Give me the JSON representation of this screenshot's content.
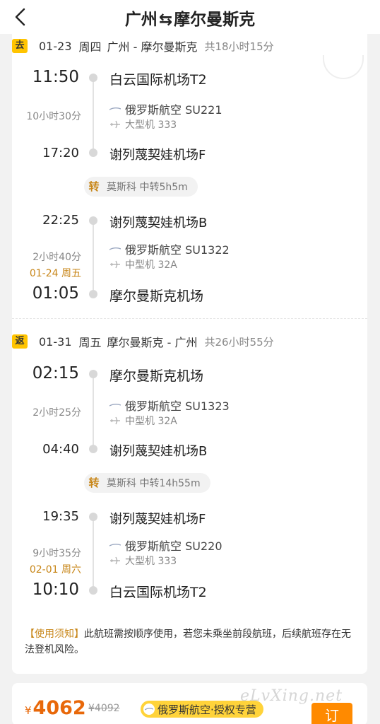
{
  "header": {
    "title_from": "广州",
    "title_arrow": "⇆",
    "title_to": "摩尔曼斯克"
  },
  "outbound": {
    "tag": "去",
    "date": "01-23",
    "weekday": "周四",
    "route": "广州 - 摩尔曼斯克",
    "total": "共18小时15分",
    "legs": [
      {
        "dep_time": "11:50",
        "dep_airport": "白云国际机场T2",
        "duration": "10小时30分",
        "airline": "俄罗斯航空 SU221",
        "aircraft": "大型机 333",
        "arr_time": "17:20",
        "arr_airport": "谢列蔑契娃机场F"
      },
      {
        "dep_time": "22:25",
        "dep_airport": "谢列蔑契娃机场B",
        "duration": "2小时40分",
        "next_day": "01-24 周五",
        "airline": "俄罗斯航空 SU1322",
        "aircraft": "中型机 32A",
        "arr_time": "01:05",
        "arr_airport": "摩尔曼斯克机场"
      }
    ],
    "transfer": {
      "label": "转",
      "text": "莫斯科 中转5h5m"
    }
  },
  "return": {
    "tag": "返",
    "date": "01-31",
    "weekday": "周五",
    "route": "摩尔曼斯克 - 广州",
    "total": "共26小时55分",
    "legs": [
      {
        "dep_time": "02:15",
        "dep_airport": "摩尔曼斯克机场",
        "duration": "2小时25分",
        "airline": "俄罗斯航空 SU1323",
        "aircraft": "中型机 32A",
        "arr_time": "04:40",
        "arr_airport": "谢列蔑契娃机场B"
      },
      {
        "dep_time": "19:35",
        "dep_airport": "谢列蔑契娃机场F",
        "duration": "9小时35分",
        "next_day": "02-01 周六",
        "airline": "俄罗斯航空 SU220",
        "aircraft": "大型机 333",
        "arr_time": "10:10",
        "arr_airport": "白云国际机场T2"
      }
    ],
    "transfer": {
      "label": "转",
      "text": "莫斯科 中转14h55m"
    }
  },
  "notice": {
    "title": "【使用须知】",
    "text": "此航班需按顺序使用，若您未乘坐前段航班，后续航班存在无法登机风险。"
  },
  "booking": {
    "currency": "¥",
    "price": "4062",
    "old_price": "¥4092",
    "vendor": "俄罗斯航空·授权专营",
    "book_label": "订"
  },
  "watermark": "eLvXing.net",
  "colors": {
    "accent": "#ff8a00",
    "tag_yellow": "#ffc400",
    "transfer_brown": "#c8871a"
  }
}
